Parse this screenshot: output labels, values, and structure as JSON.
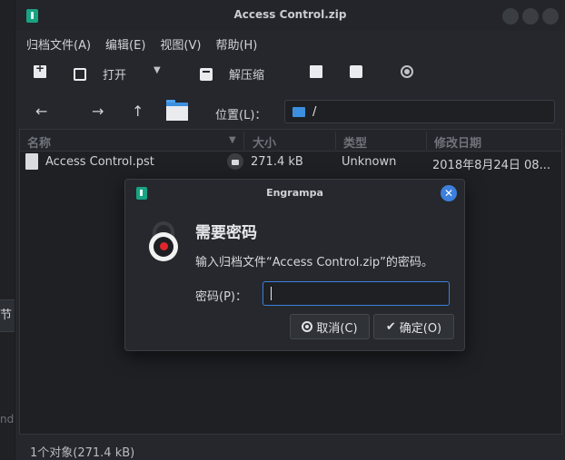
{
  "window": {
    "title": "Access Control.zip"
  },
  "menu": [
    "归档文件(A)",
    "编辑(E)",
    "视图(V)",
    "帮助(H)"
  ],
  "toolbar": {
    "open_label": "打开",
    "extract_label": "解压缩"
  },
  "nav": {
    "location_label": "位置(L)：",
    "location_value": "/"
  },
  "columns": [
    "名称",
    "大小",
    "类型",
    "修改日期"
  ],
  "files": [
    {
      "name": "Access Control.pst",
      "size": "271.4 kB",
      "type": "Unknown",
      "date": "2018年8月24日 08..."
    }
  ],
  "status": "1个对象(271.4 kB)",
  "left_fragments": {
    "a": "节",
    "b": "nd"
  },
  "dialog": {
    "title": "Engrampa",
    "heading": "需要密码",
    "message": "输入归档文件“Access Control.zip”的密码。",
    "password_label": "密码(P)：",
    "password_value": "",
    "cancel_label": "取消(C)",
    "ok_label": "确定(O)"
  },
  "colors": {
    "accent": "#3d7fdc",
    "app_icon": "#18a383",
    "lock_red": "#e0262b"
  }
}
